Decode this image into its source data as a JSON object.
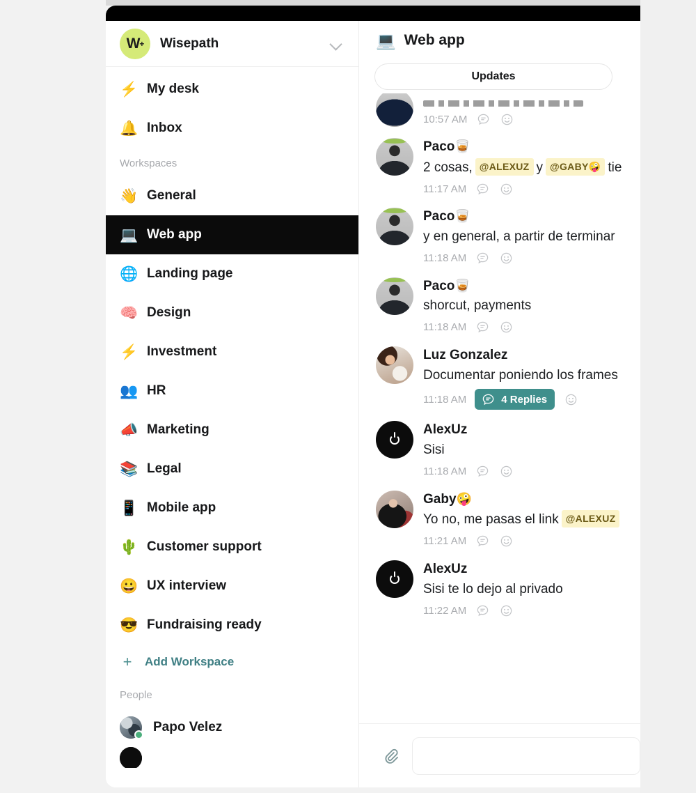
{
  "window": {
    "titlebar_color": "#000000"
  },
  "sidebar": {
    "workspace": {
      "logo_text": "W",
      "logo_superscript": "+",
      "name": "Wisepath",
      "chevron_icon": "chevron-down-icon"
    },
    "top_items": [
      {
        "emoji": "⚡",
        "label": "My desk",
        "icon_name": "lightning-icon"
      },
      {
        "emoji": "🔔",
        "label": "Inbox",
        "icon_name": "bell-icon"
      }
    ],
    "workspaces_section_label": "Workspaces",
    "workspaces": [
      {
        "emoji": "👋",
        "label": "General",
        "icon_name": "waving-hand-icon",
        "selected": false
      },
      {
        "emoji": "💻",
        "label": "Web app",
        "icon_name": "laptop-icon",
        "selected": true
      },
      {
        "emoji": "🌐",
        "label": "Landing page",
        "icon_name": "globe-icon",
        "selected": false
      },
      {
        "emoji": "🧠",
        "label": "Design",
        "icon_name": "brain-icon",
        "selected": false
      },
      {
        "emoji": "⚡",
        "label": "Investment",
        "icon_name": "lightning-icon",
        "selected": false
      },
      {
        "emoji": "👥",
        "label": "HR",
        "icon_name": "people-icon",
        "selected": false
      },
      {
        "emoji": "📣",
        "label": "Marketing",
        "icon_name": "megaphone-icon",
        "selected": false
      },
      {
        "emoji": "📚",
        "label": "Legal",
        "icon_name": "books-icon",
        "selected": false
      },
      {
        "emoji": "📱",
        "label": "Mobile app",
        "icon_name": "mobile-phone-icon",
        "selected": false
      },
      {
        "emoji": "🌵",
        "label": "Customer support",
        "icon_name": "cactus-icon",
        "selected": false
      },
      {
        "emoji": "😀",
        "label": "UX interview",
        "icon_name": "grinning-face-icon",
        "selected": false
      },
      {
        "emoji": "😎",
        "label": "Fundraising ready",
        "icon_name": "sunglasses-face-icon",
        "selected": false
      }
    ],
    "add_workspace": {
      "plus_icon": "plus-icon",
      "label": "Add Workspace",
      "color": "#3f7f84"
    },
    "people_section_label": "People",
    "people": [
      {
        "name": "Papo Velez",
        "status": "online",
        "status_color": "#4caf7d"
      }
    ]
  },
  "chat": {
    "header": {
      "emoji": "💻",
      "title": "Web app",
      "icon_name": "laptop-icon"
    },
    "tabs": [
      {
        "label": "Updates",
        "active": true
      }
    ],
    "messages": [
      {
        "id": "m0",
        "author": "",
        "author_emoji": "",
        "text": "",
        "time": "10:57 AM",
        "avatar": "av-partial",
        "partial": true,
        "reply_icon": "reply-bubble-icon",
        "emoji_icon": "emoji-reaction-icon"
      },
      {
        "id": "m1",
        "author": "Paco",
        "author_emoji": "🥃",
        "text_before": "2 cosas,",
        "mention_1": "@ALEXUZ",
        "text_mid": "y",
        "mention_2": "@GABY🤪",
        "text_after": "tie",
        "time": "11:17 AM",
        "avatar": "av-paco",
        "reply_icon": "reply-bubble-icon",
        "emoji_icon": "emoji-reaction-icon"
      },
      {
        "id": "m2",
        "author": "Paco",
        "author_emoji": "🥃",
        "text": "y en general, a partir de terminar",
        "time": "11:18 AM",
        "avatar": "av-paco",
        "reply_icon": "reply-bubble-icon",
        "emoji_icon": "emoji-reaction-icon"
      },
      {
        "id": "m3",
        "author": "Paco",
        "author_emoji": "🥃",
        "text": "shorcut, payments",
        "time": "11:18 AM",
        "avatar": "av-paco",
        "reply_icon": "reply-bubble-icon",
        "emoji_icon": "emoji-reaction-icon"
      },
      {
        "id": "m4",
        "author": "Luz Gonzalez",
        "author_emoji": "",
        "text": "Documentar poniendo los frames",
        "time": "11:18 AM",
        "avatar": "av-luz",
        "replies_badge": "4 Replies",
        "replies_badge_color": "#3f8f8c",
        "reply_icon": "reply-bubble-icon",
        "emoji_icon": "emoji-reaction-icon"
      },
      {
        "id": "m5",
        "author": "AlexUz",
        "author_emoji": "",
        "text": "Sisi",
        "time": "11:18 AM",
        "avatar": "av-alex",
        "reply_icon": "reply-bubble-icon",
        "emoji_icon": "emoji-reaction-icon"
      },
      {
        "id": "m6",
        "author": "Gaby",
        "author_emoji": "🤪",
        "text_before": "Yo no, me pasas el link",
        "mention_1": "@ALEXUZ",
        "time": "11:21 AM",
        "avatar": "av-gaby",
        "reply_icon": "reply-bubble-icon",
        "emoji_icon": "emoji-reaction-icon"
      },
      {
        "id": "m7",
        "author": "AlexUz",
        "author_emoji": "",
        "text": "Sisi te lo dejo al privado",
        "time": "11:22 AM",
        "avatar": "av-alex",
        "reply_icon": "reply-bubble-icon",
        "emoji_icon": "emoji-reaction-icon"
      }
    ],
    "composer": {
      "attach_icon": "paperclip-icon",
      "value": "",
      "placeholder": ""
    }
  },
  "colors": {
    "accent_teal": "#3f8f8c",
    "link_teal": "#3f7f84",
    "mention_bg": "#fbf3c9",
    "logo_green": "#d5ea78",
    "selected_bg": "#0b0b0b",
    "online_green": "#4caf7d"
  }
}
